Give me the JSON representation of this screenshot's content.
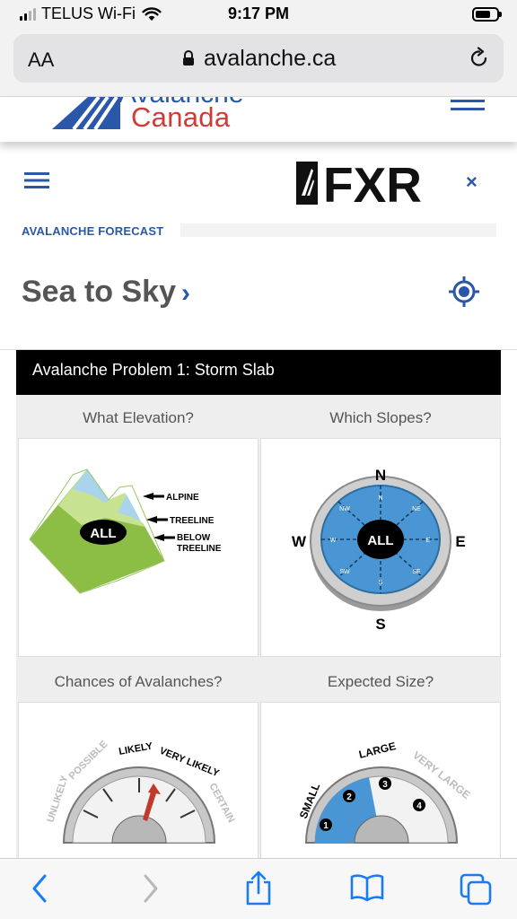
{
  "status_bar": {
    "carrier": "TELUS Wi-Fi",
    "time": "9:17 PM"
  },
  "browser": {
    "text_size": "AA",
    "url": "avalanche.ca"
  },
  "site_header": {
    "brand_name": "Canada",
    "brand_name_partial": "Avalanche"
  },
  "panel": {
    "sponsor": "FXR",
    "section_label": "AVALANCHE FORECAST",
    "region": "Sea to Sky",
    "chevron": "›",
    "close": "×"
  },
  "problem": {
    "title": "Avalanche Problem 1: Storm Slab",
    "elevation": {
      "heading": "What Elevation?",
      "center": "ALL",
      "labels": [
        "ALPINE",
        "TREELINE",
        "BELOW",
        "TREELINE"
      ]
    },
    "slopes": {
      "heading": "Which Slopes?",
      "center": "ALL",
      "compass": [
        "N",
        "E",
        "S",
        "W"
      ],
      "inner": [
        "N",
        "NE",
        "E",
        "SE",
        "S",
        "SW",
        "W",
        "NW"
      ]
    },
    "chances": {
      "heading": "Chances of Avalanches?",
      "scale": [
        "UNLIKELY",
        "POSSIBLE",
        "LIKELY",
        "VERY LIKELY",
        "CERTAIN"
      ]
    },
    "size": {
      "heading": "Expected Size?",
      "scale": [
        "SMALL",
        "LARGE",
        "VERY LARGE"
      ],
      "numbers": [
        "1",
        "2",
        "3",
        "4"
      ]
    }
  },
  "colors": {
    "brand_blue": "#2a57a8",
    "brand_red": "#d23a36",
    "compass_blue": "#4a96d4",
    "ios_blue": "#1a7cf5"
  }
}
